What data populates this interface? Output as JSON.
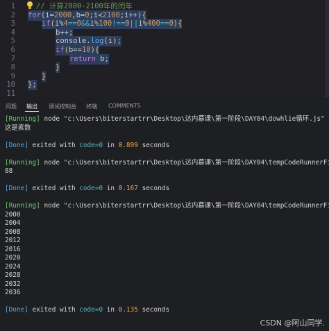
{
  "editor": {
    "lines": [
      {
        "n": "1",
        "tokens": [
          {
            "t": "// 计算2000-2100年的闰年",
            "c": "cmt"
          }
        ],
        "indent": 12
      },
      {
        "n": "2",
        "tokens": [
          {
            "t": "for",
            "c": "kw"
          },
          {
            "t": "(",
            "c": "punct"
          },
          {
            "t": "i=",
            "c": ""
          },
          {
            "t": "2000",
            "c": "num"
          },
          {
            "t": ",b=",
            "c": ""
          },
          {
            "t": "0",
            "c": "num"
          },
          {
            "t": ";i<",
            "c": ""
          },
          {
            "t": "2100",
            "c": "num"
          },
          {
            "t": ";i++",
            "c": ""
          },
          {
            "t": "){",
            "c": "punct"
          }
        ],
        "indent": 0,
        "sel": true
      },
      {
        "n": "3",
        "tokens": [
          {
            "t": "if",
            "c": "kw"
          },
          {
            "t": "(",
            "c": "punct"
          },
          {
            "t": "i%",
            "c": ""
          },
          {
            "t": "4",
            "c": "num"
          },
          {
            "t": "==",
            "c": "op"
          },
          {
            "t": "0",
            "c": "num"
          },
          {
            "t": "&&",
            "c": "op"
          },
          {
            "t": "i%",
            "c": ""
          },
          {
            "t": "100",
            "c": "num"
          },
          {
            "t": "!==",
            "c": "op"
          },
          {
            "t": "0",
            "c": "num"
          },
          {
            "t": "||",
            "c": "op"
          },
          {
            "t": "i%",
            "c": ""
          },
          {
            "t": "400",
            "c": "num"
          },
          {
            "t": "==",
            "c": "op"
          },
          {
            "t": "0",
            "c": "num"
          },
          {
            "t": "){",
            "c": "punct"
          }
        ],
        "indent": 20,
        "sel": true
      },
      {
        "n": "4",
        "tokens": [
          {
            "t": "b++;",
            "c": ""
          }
        ],
        "indent": 40,
        "sel": true
      },
      {
        "n": "5",
        "tokens": [
          {
            "t": "console.",
            "c": ""
          },
          {
            "t": "log",
            "c": "fn"
          },
          {
            "t": "(",
            "c": "punct"
          },
          {
            "t": "i",
            "c": ""
          },
          {
            "t": ");",
            "c": "punct"
          }
        ],
        "indent": 40,
        "sel": true
      },
      {
        "n": "6",
        "tokens": [
          {
            "t": "if",
            "c": "kw"
          },
          {
            "t": "(",
            "c": "punct"
          },
          {
            "t": "b==",
            "c": ""
          },
          {
            "t": "10",
            "c": "num"
          },
          {
            "t": "){",
            "c": "punct"
          }
        ],
        "indent": 40,
        "sel": true
      },
      {
        "n": "7",
        "tokens": [
          {
            "t": "return",
            "c": "kw"
          },
          {
            "t": " b;",
            "c": ""
          }
        ],
        "indent": 60,
        "sel": true
      },
      {
        "n": "8",
        "tokens": [
          {
            "t": "}",
            "c": "punct"
          }
        ],
        "indent": 40,
        "sel": true
      },
      {
        "n": "9",
        "tokens": [
          {
            "t": "}",
            "c": "punct"
          }
        ],
        "indent": 20,
        "sel": true
      },
      {
        "n": "10",
        "tokens": [
          {
            "t": "};",
            "c": "punct"
          }
        ],
        "indent": 0,
        "sel": true
      },
      {
        "n": "11",
        "tokens": [],
        "indent": 0
      }
    ]
  },
  "panel": {
    "tabs": [
      "问题",
      "输出",
      "调试控制台",
      "终端",
      "COMMENTS"
    ],
    "active": 1
  },
  "output": [
    {
      "parts": [
        {
          "t": "[Running]",
          "c": "green"
        },
        {
          "t": " node \"c:\\Users\\biterstartrr\\Desktop\\达内慕课\\第一阶段\\DAY04\\dowhlie循环.js\"",
          "c": ""
        }
      ]
    },
    {
      "parts": [
        {
          "t": "这是素数",
          "c": ""
        }
      ]
    },
    {
      "parts": []
    },
    {
      "parts": [
        {
          "t": "[Done]",
          "c": "blue"
        },
        {
          "t": " exited with ",
          "c": ""
        },
        {
          "t": "code=0",
          "c": "cyan"
        },
        {
          "t": " in ",
          "c": ""
        },
        {
          "t": "0.899",
          "c": "orange"
        },
        {
          "t": " seconds",
          "c": ""
        }
      ]
    },
    {
      "parts": []
    },
    {
      "parts": [
        {
          "t": "[Running]",
          "c": "green"
        },
        {
          "t": " node \"c:\\Users\\biterstartrr\\Desktop\\达内慕课\\第一阶段\\DAY04\\tempCodeRunnerFile.",
          "c": ""
        }
      ]
    },
    {
      "parts": [
        {
          "t": "88",
          "c": ""
        }
      ]
    },
    {
      "parts": []
    },
    {
      "parts": [
        {
          "t": "[Done]",
          "c": "blue"
        },
        {
          "t": " exited with ",
          "c": ""
        },
        {
          "t": "code=0",
          "c": "cyan"
        },
        {
          "t": " in ",
          "c": ""
        },
        {
          "t": "0.167",
          "c": "orange"
        },
        {
          "t": " seconds",
          "c": ""
        }
      ]
    },
    {
      "parts": []
    },
    {
      "parts": [
        {
          "t": "[Running]",
          "c": "green"
        },
        {
          "t": " node \"c:\\Users\\biterstartrr\\Desktop\\达内慕课\\第一阶段\\DAY04\\tempCodeRunnerFile.",
          "c": ""
        }
      ]
    },
    {
      "parts": [
        {
          "t": "2000",
          "c": ""
        }
      ]
    },
    {
      "parts": [
        {
          "t": "2004",
          "c": ""
        }
      ]
    },
    {
      "parts": [
        {
          "t": "2008",
          "c": ""
        }
      ]
    },
    {
      "parts": [
        {
          "t": "2012",
          "c": ""
        }
      ]
    },
    {
      "parts": [
        {
          "t": "2016",
          "c": ""
        }
      ]
    },
    {
      "parts": [
        {
          "t": "2020",
          "c": ""
        }
      ]
    },
    {
      "parts": [
        {
          "t": "2024",
          "c": ""
        }
      ]
    },
    {
      "parts": [
        {
          "t": "2028",
          "c": ""
        }
      ]
    },
    {
      "parts": [
        {
          "t": "2032",
          "c": ""
        }
      ]
    },
    {
      "parts": [
        {
          "t": "2036",
          "c": ""
        }
      ]
    },
    {
      "parts": []
    },
    {
      "parts": [
        {
          "t": "[Done]",
          "c": "blue"
        },
        {
          "t": " exited with ",
          "c": ""
        },
        {
          "t": "code=0",
          "c": "cyan"
        },
        {
          "t": " in ",
          "c": ""
        },
        {
          "t": "0.135",
          "c": "orange"
        },
        {
          "t": " seconds",
          "c": ""
        }
      ]
    }
  ],
  "watermark": "CSDN @阿山同学."
}
